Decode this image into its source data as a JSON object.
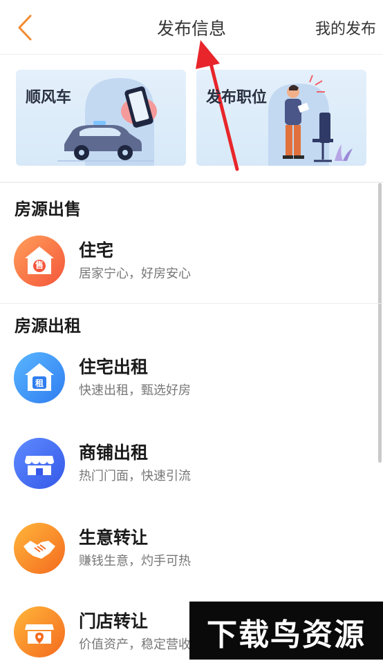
{
  "header": {
    "title": "发布信息",
    "my_publish": "我的发布"
  },
  "banners": [
    {
      "label": "顺风车"
    },
    {
      "label": "发布职位"
    }
  ],
  "sections": [
    {
      "title": "房源出售",
      "items": [
        {
          "name": "住宅",
          "desc": "居家宁心，好房安心",
          "icon_char": "售",
          "icon": "house-sale-icon"
        }
      ]
    },
    {
      "title": "房源出租",
      "items": [
        {
          "name": "住宅出租",
          "desc": "快速出租，甄选好房",
          "icon_char": "租",
          "icon": "house-rent-icon"
        },
        {
          "name": "商铺出租",
          "desc": "热门门面，快速引流",
          "icon": "shop-icon"
        },
        {
          "name": "生意转让",
          "desc": "赚钱生意，灼手可热",
          "icon": "handshake-icon"
        },
        {
          "name": "门店转让",
          "desc": "价值资产，稳定营收",
          "icon": "store-location-icon"
        }
      ]
    }
  ],
  "watermark": {
    "text": "下载鸟资源"
  },
  "colors": {
    "accent": "#f28a2e",
    "annotation_arrow": "#e8252b"
  }
}
